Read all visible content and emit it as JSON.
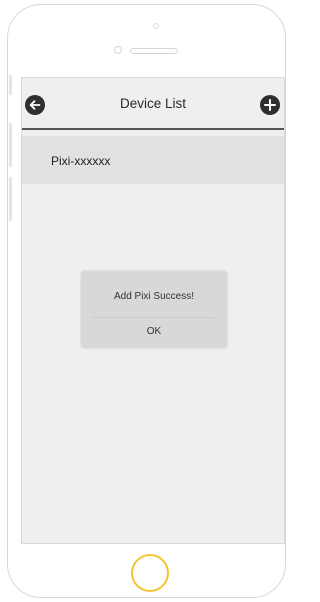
{
  "header": {
    "title": "Device List",
    "back_icon": "arrow-left-circle-icon",
    "add_icon": "plus-circle-icon"
  },
  "devices": [
    {
      "name": "Pixi-xxxxxx"
    }
  ],
  "dialog": {
    "message": "Add Pixi Success!",
    "ok_label": "OK"
  },
  "colors": {
    "home_button_ring": "#f5c431",
    "screen_background": "#efefef",
    "list_item_background": "#e1e1e1",
    "dialog_background": "#d8d8d8",
    "header_icon": "#2f2f2f"
  }
}
